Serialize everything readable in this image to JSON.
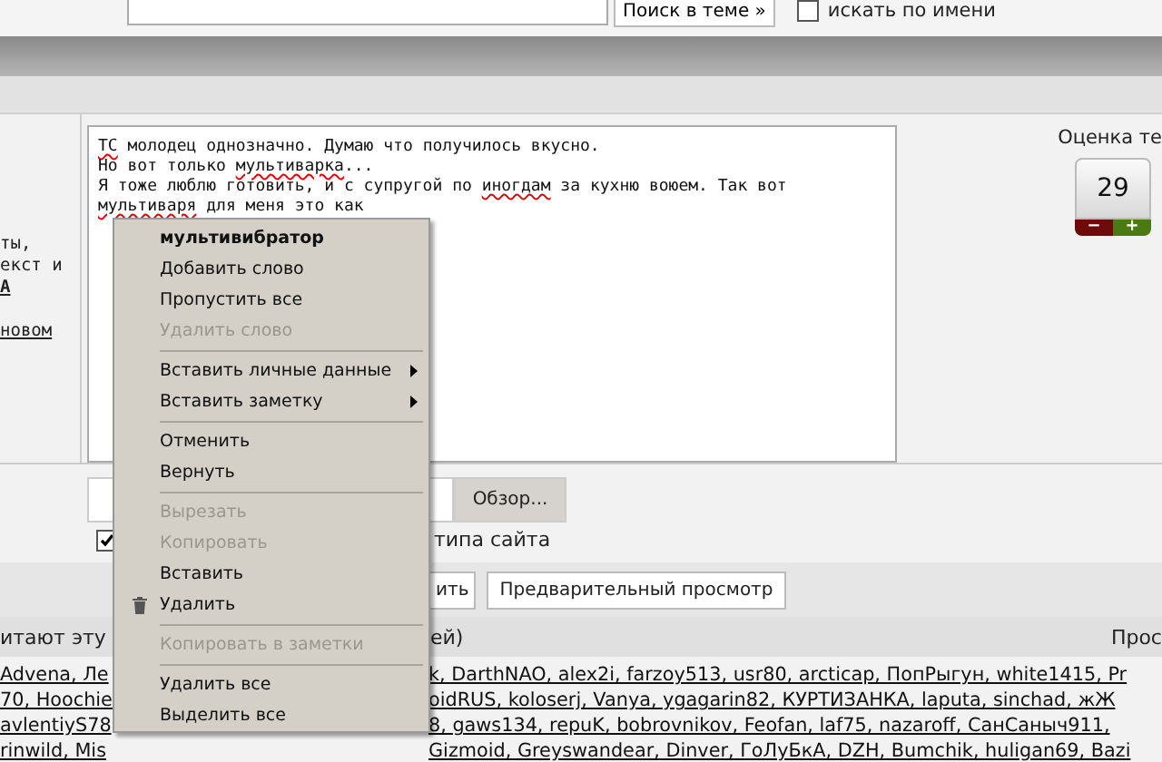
{
  "search_bar": {
    "button": "Поиск в теме »",
    "by_name": {
      "label": "искать по имени",
      "checked": false
    }
  },
  "left_column": [
    {
      "text": "ты,",
      "kind": "plain"
    },
    {
      "text": "екст и",
      "kind": "plain"
    },
    {
      "text": "А",
      "kind": "bold-link"
    },
    {
      "text": "новом",
      "kind": "link"
    }
  ],
  "message": {
    "lines": [
      [
        {
          "text": "ТС",
          "misspelled": true
        },
        {
          "text": " молодец однозначно. Думаю что получилось вкусно.",
          "misspelled": false
        }
      ],
      [
        {
          "text": "Но вот только ",
          "misspelled": false
        },
        {
          "text": "мультиварка",
          "misspelled": true
        },
        {
          "text": "...",
          "misspelled": false
        }
      ],
      [
        {
          "text": "Я тоже люблю готовить, и с супругой по ",
          "misspelled": false
        },
        {
          "text": "иногдам",
          "misspelled": true
        },
        {
          "text": " за кухню воюем. Так вот",
          "misspelled": false
        }
      ],
      [
        {
          "text": "мультиваря",
          "misspelled": true
        },
        {
          "text": " для меня это как",
          "misspelled": false
        }
      ]
    ]
  },
  "rating": {
    "title": "Оценка те",
    "score": "29",
    "minus": "−",
    "plus": "+"
  },
  "attachment": {
    "browse_button": "Обзор..."
  },
  "site_logo_option": {
    "label": "типа сайта",
    "checked": true
  },
  "buttons": [
    {
      "label": "ить",
      "kind": "plain"
    },
    {
      "label": "Предварительный просмотр",
      "kind": "white"
    }
  ],
  "readers_bar": {
    "left": "итают эту",
    "middle": "ей)",
    "right": "Прос"
  },
  "readers": [
    {
      "left": "Advena, Ле",
      "right": "k, DarthNAO, alex2i, farzoy513, usr80, arcticap, ПопРыгун, white1415, Pr"
    },
    {
      "left": "70, Hoochie",
      "right": "oidRUS, koloserj, Vanya, ygagarin82, КУРТИЗАНКА, laputa, sinchad, жЖ"
    },
    {
      "left": "avlentiyS78",
      "right": "8, gaws134, repuK, bobrovnikov, Feofan, laf75, nazaroff, СанСаныч911,"
    },
    {
      "left": "rinwild, Mis",
      "right": "Gizmoid, Greyswandear, Dinver, ГоЛуБкА, DZH, Bumchik, huligan69, Bazi"
    }
  ],
  "context_menu": [
    {
      "kind": "item",
      "label": "мультивибратор",
      "bold": true,
      "disabled": false
    },
    {
      "kind": "item",
      "label": "Добавить слово",
      "disabled": false
    },
    {
      "kind": "item",
      "label": "Пропустить все",
      "disabled": false
    },
    {
      "kind": "item",
      "label": "Удалить слово",
      "disabled": true
    },
    {
      "kind": "separator"
    },
    {
      "kind": "submenu",
      "label": "Вставить личные данные",
      "disabled": false
    },
    {
      "kind": "submenu",
      "label": "Вставить заметку",
      "disabled": false
    },
    {
      "kind": "separator"
    },
    {
      "kind": "item",
      "label": "Отменить",
      "disabled": false
    },
    {
      "kind": "item",
      "label": "Вернуть",
      "disabled": false
    },
    {
      "kind": "separator"
    },
    {
      "kind": "item",
      "label": "Вырезать",
      "disabled": true
    },
    {
      "kind": "item",
      "label": "Копировать",
      "disabled": true
    },
    {
      "kind": "item",
      "label": "Вставить",
      "disabled": false
    },
    {
      "kind": "delete",
      "label": "Удалить",
      "disabled": false
    },
    {
      "kind": "separator"
    },
    {
      "kind": "item",
      "label": "Копировать в заметки",
      "disabled": true
    },
    {
      "kind": "separator"
    },
    {
      "kind": "item",
      "label": "Удалить все",
      "disabled": false
    },
    {
      "kind": "item",
      "label": "Выделить все",
      "disabled": false
    }
  ]
}
